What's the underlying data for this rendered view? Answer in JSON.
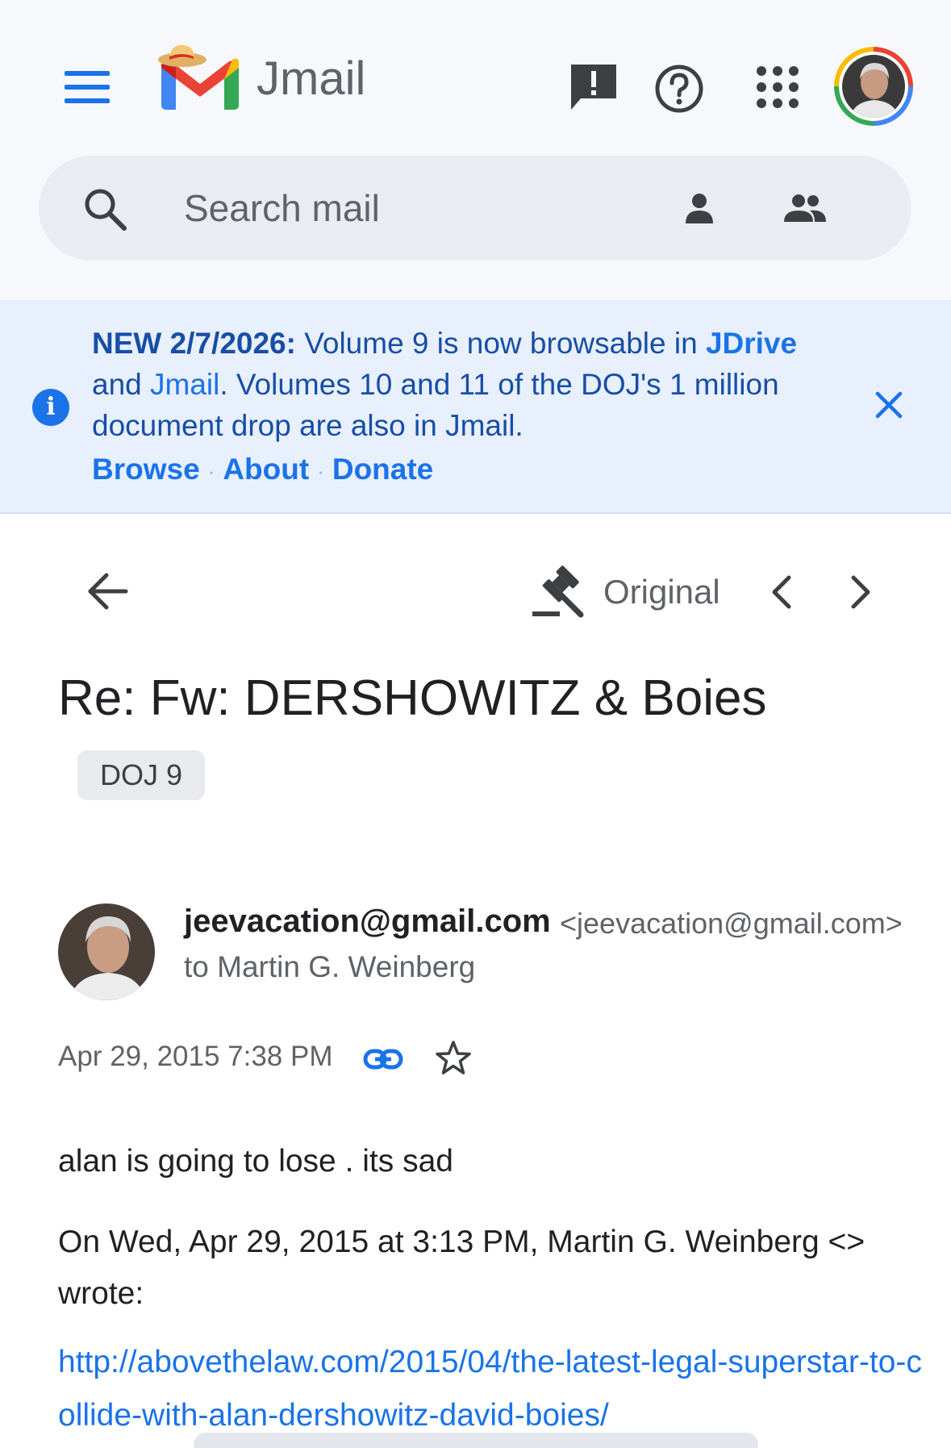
{
  "app": {
    "title": "Jmail",
    "brand_colors": {
      "blue": "#4285f4",
      "red": "#ea4335",
      "yellow": "#fbbc04",
      "green": "#34a853"
    }
  },
  "header": {
    "menu_icon": "hamburger-menu-icon",
    "feedback_icon": "feedback-icon",
    "help_icon": "help-icon",
    "apps_icon": "apps-grid-icon",
    "avatar_icon": "account-avatar"
  },
  "search": {
    "placeholder": "Search mail",
    "person_icon": "person-icon",
    "people_icon": "people-icon"
  },
  "banner": {
    "bold_prefix": "NEW 2/7/2026:",
    "text_1": " Volume 9 is now browsable in ",
    "link_jdrive": "JDrive",
    "text_2": " and ",
    "link_jmail": "Jmail",
    "text_3": ". Volumes 10 and 11 of the DOJ's 1 million document drop are also in Jmail.",
    "links": [
      "Browse",
      "About",
      "Donate"
    ],
    "separator": "·"
  },
  "toolbar": {
    "original_label": "Original"
  },
  "message": {
    "subject": "Re: Fw: DERSHOWITZ & Boies",
    "label": "DOJ 9",
    "sender_name": "jeevacation@gmail.com",
    "sender_email": "<jeevacation@gmail.com>",
    "to_line": "to Martin G. Weinberg",
    "date": "Apr 29, 2015 7:38 PM",
    "body": "alan is going to lose . its sad",
    "quote_header": "On Wed, Apr 29, 2015 at 3:13 PM, Martin G. Weinberg <> wrote:",
    "quoted_link": "http://abovethelaw.com/2015/04/the-latest-legal-superstar-to-collide-with-alan-dershowitz-david-boies/"
  }
}
